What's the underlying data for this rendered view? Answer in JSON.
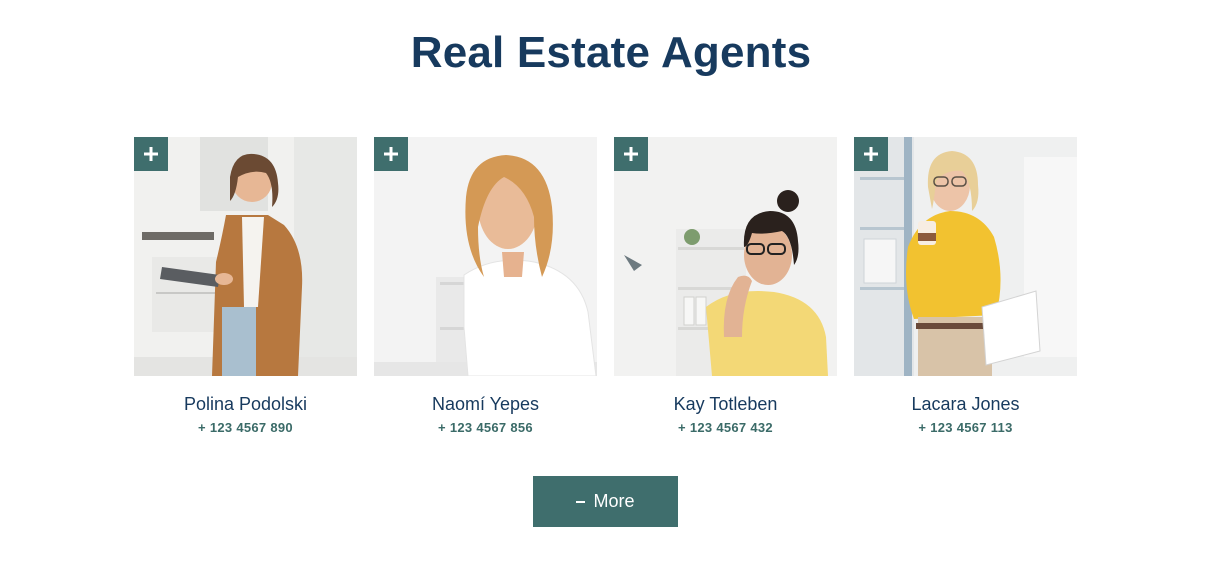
{
  "page": {
    "title": "Real Estate Agents"
  },
  "agents": [
    {
      "name": "Polina Podolski",
      "phone": "+ 123 4567 890",
      "photo_icon": "woman-with-tablet-photo",
      "accent": "#b7783f"
    },
    {
      "name": "Naomí Yepes",
      "phone": "+ 123 4567 856",
      "photo_icon": "blonde-woman-photo",
      "accent": "#ffffff"
    },
    {
      "name": "Kay Totleben",
      "phone": "+ 123 4567 432",
      "photo_icon": "woman-with-glasses-photo",
      "accent": "#f4d77a"
    },
    {
      "name": "Lacara Jones",
      "phone": "+ 123 4567 113",
      "photo_icon": "woman-in-yellow-sweater-photo",
      "accent": "#f2c230"
    }
  ],
  "actions": {
    "more_label": "More",
    "more_icon": "minus-icon",
    "card_add_icon": "plus-icon"
  },
  "colors": {
    "title": "#173a5e",
    "button": "#3f6e6d",
    "phone": "#3b6b68"
  }
}
